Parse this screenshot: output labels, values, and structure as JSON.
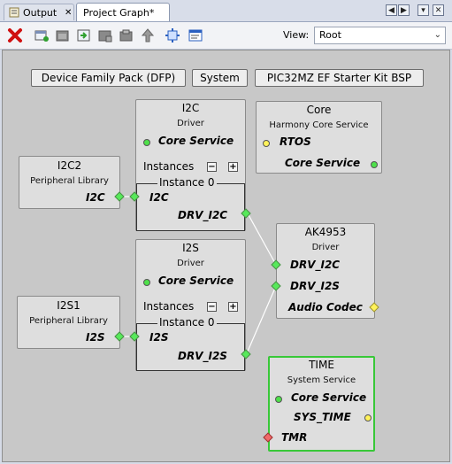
{
  "tabs": [
    {
      "label": "Output"
    },
    {
      "label": "Project Graph*"
    }
  ],
  "window_buttons": {
    "left": "◀",
    "right": "▶",
    "menu": "▾",
    "close": "✕"
  },
  "toolbar": {
    "view_label": "View:",
    "view_value": "Root",
    "icons": [
      "delete-icon",
      "new-group-icon",
      "group-icon",
      "import-icon",
      "export-icon",
      "save-icon",
      "up-arrow-icon",
      "fit-icon",
      "properties-icon"
    ]
  },
  "canvas": {
    "pills": [
      "Device Family Pack (DFP)",
      "System",
      "PIC32MZ EF Starter Kit BSP"
    ],
    "i2c_driver": {
      "title": "I2C",
      "sub": "Driver",
      "core_service": "Core Service",
      "instances": "Instances",
      "instance0": "Instance 0",
      "port_i2c": "I2C",
      "port_drv": "DRV_I2C"
    },
    "core": {
      "title": "Core",
      "sub": "Harmony Core Service",
      "rtos": "RTOS",
      "core_service": "Core Service"
    },
    "i2c2": {
      "title": "I2C2",
      "sub": "Peripheral Library",
      "port": "I2C"
    },
    "ak4953": {
      "title": "AK4953",
      "sub": "Driver",
      "drv_i2c": "DRV_I2C",
      "drv_i2s": "DRV_I2S",
      "audio": "Audio Codec"
    },
    "i2s_driver": {
      "title": "I2S",
      "sub": "Driver",
      "core_service": "Core Service",
      "instances": "Instances",
      "instance0": "Instance 0",
      "port_i2s": "I2S",
      "port_drv": "DRV_I2S"
    },
    "i2s1": {
      "title": "I2S1",
      "sub": "Peripheral Library",
      "port": "I2S"
    },
    "time": {
      "title": "TIME",
      "sub": "System Service",
      "core_service": "Core Service",
      "sys_time": "SYS_TIME",
      "tmr": "TMR"
    }
  },
  "colors": {
    "green": "#4ee04a",
    "yellow": "#fff25a",
    "red": "#f06a6a",
    "selected_border": "#38c838"
  }
}
